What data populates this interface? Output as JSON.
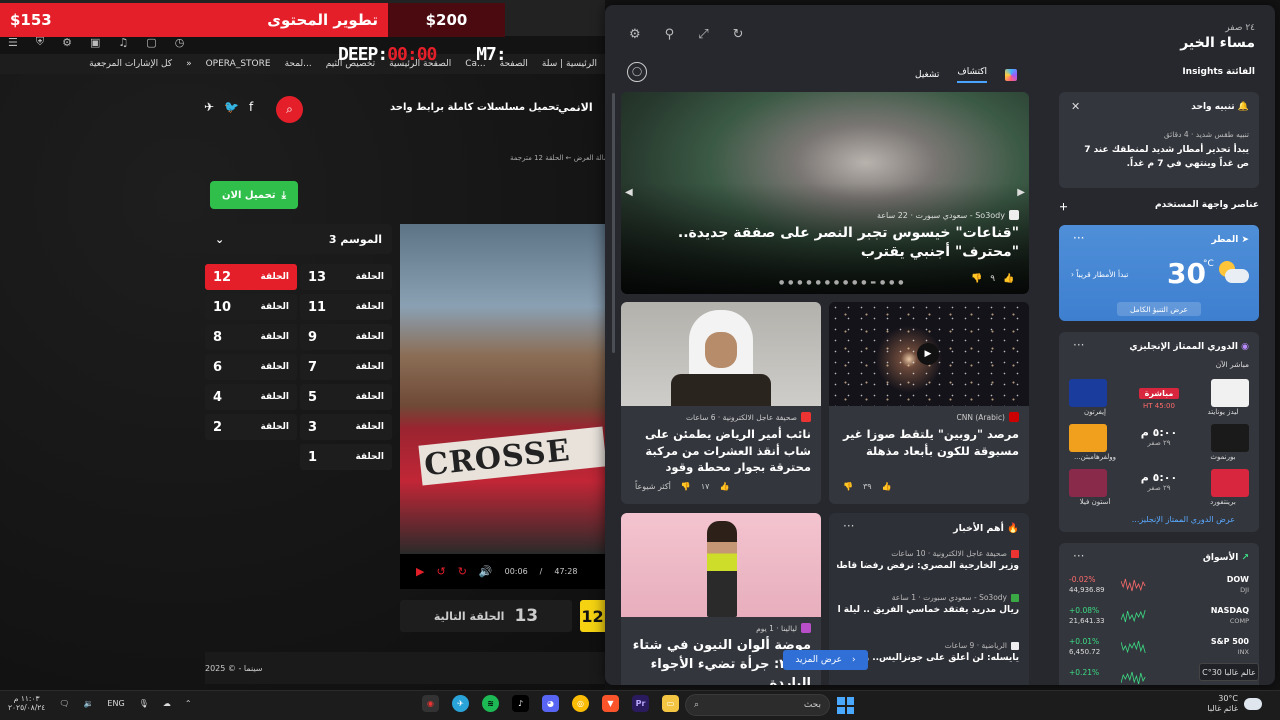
{
  "promo": {
    "label": "تطوير المحتوى",
    "price_a": "$153",
    "price_b": "$200"
  },
  "overlay": {
    "deep_label": "DEEP:",
    "deep_value": "00:00",
    "m7_label": "M7:"
  },
  "bookmarks": {
    "items": [
      "الرئيسية | سلة",
      "الصفحة",
      "Ca...",
      "الصفحة الرئيسية",
      "تخصيص الثيم",
      "لمحة...",
      "OPERA_STORE"
    ],
    "all_label": "كل الإشارات المرجعية"
  },
  "site": {
    "nav_anime": "الانمي",
    "download_link": "تحميل مسلسلات كاملة برابط واحد",
    "breadcrumb": "مالة العرض ← الحلقة 12 مترجمة",
    "download_button": "تحميل الان",
    "season_label": "الموسم 3",
    "episode_word": "الحلقة",
    "episodes": [
      {
        "num": "13",
        "active": false
      },
      {
        "num": "12",
        "active": true
      },
      {
        "num": "11",
        "active": false
      },
      {
        "num": "10",
        "active": false
      },
      {
        "num": "9",
        "active": false
      },
      {
        "num": "8",
        "active": false
      },
      {
        "num": "7",
        "active": false
      },
      {
        "num": "6",
        "active": false
      },
      {
        "num": "5",
        "active": false
      },
      {
        "num": "4",
        "active": false
      },
      {
        "num": "3",
        "active": false
      },
      {
        "num": "2",
        "active": false
      },
      {
        "num": "1",
        "active": false
      }
    ],
    "player": {
      "sign_text": "CROSSE",
      "time_current": "00:06",
      "time_total": "47:28"
    },
    "next_episode_label": "الحلقة التالية",
    "next_episode_num": "13",
    "current_episode_num": "12",
    "footer_text": "سينما - © 2025"
  },
  "widgets": {
    "date": "٢٤ صفر",
    "greeting": "مساء الخير",
    "insights_label": "Insights الفائتة",
    "tabs": [
      "اكتشاف",
      "تشغيل"
    ],
    "hero": {
      "source": "So3ody - سعودي سبورت · 22 ساعة",
      "title": "\"قناعات\" خيسوس تجبر النصر على صفقة جديدة.. \"محترف\" أجنبي يقترب",
      "likes": "٩"
    },
    "card_galaxy": {
      "source": "CNN (Arabic)",
      "title": "مرصد \"روبين\" يلتقط صوزا غير مسبوقة للكون بأبعاد مذهلة",
      "likes": "٣٩"
    },
    "card_prince": {
      "source": "صحيفة عاجل الالكترونية · 6 ساعات",
      "title": "نائب أمير الرياض يطمئن على شاب أنقذ العشرات من مركبة محترقة بجوار محطة وقود",
      "likes": "١٧",
      "trending": "أكثر شيوعاً"
    },
    "card_fashion": {
      "source": "ليالينا · 1 يوم",
      "title": "موضة ألوان النيون في شتاء ٢٠٢٦: جرأة تضيء الأجواء الباردة"
    },
    "top_news": {
      "title": "أهم الأخبار",
      "items": [
        {
          "source": "صحيفة عاجل الالكترونية · 10 ساعات",
          "title": "وزير الخارجية المصري: نرفض رفضا قاطعا تهجير الفلسطينيين من غزة وأوهام ما يسم..."
        },
        {
          "source": "So3ody - سعودي سبورت · 1 ساعة",
          "title": "ريال مدريد يفتقد خماسي الفريق .. ليلة البداية تتحول لكابوس ألونسو"
        },
        {
          "source": "الرياضية · 9 ساعات",
          "title": "يايسله: لن أعلق على جونزاليس.. والتعاقد..."
        }
      ]
    },
    "see_more": "عرض المزيد",
    "alert": {
      "title": "تنبيه واحد",
      "source": "تنبيه طقس شديد · 4 دقائق",
      "text": "يبدأ تحذير أمطار شديد لمنطقك عند 7 ص غداً وينتهي في 7 م غداً."
    },
    "ui_elements_label": "عناصر واجهة المستخدم",
    "weather": {
      "title": "المطر",
      "temp": "30",
      "unit": "°C",
      "rain_note": "تبدأ الأمطار قريباً",
      "forecast_button": "عرض التنبؤ الكامل"
    },
    "league": {
      "title": "الدوري الممتاز الإنجليزي",
      "live_label": "مباشر الآن",
      "matches": [
        {
          "home": "ليدز يونايتد",
          "away": "إيفرتون",
          "center": "مباشرة",
          "sub": "HT 45:00",
          "home_color": "#f1f1f1",
          "away_color": "#1a3c9c"
        },
        {
          "home": "بورنموث",
          "away": "وولفرهامبتن...",
          "center": "٥:٠٠ م",
          "sub": "٢٩ صفر",
          "home_color": "#1a1a1a",
          "away_color": "#f0a01c"
        },
        {
          "home": "برينتفورد",
          "away": "أستون فيلا",
          "center": "٥:٠٠ م",
          "sub": "٢٩ صفر",
          "home_color": "#d7263d",
          "away_color": "#8a2a4b"
        }
      ],
      "link": "عرض الدوري الممتاز الإنجليز..."
    },
    "markets": {
      "title": "الأسواق",
      "rows": [
        {
          "name": "DOW",
          "sub": "DJI",
          "change": "-0.02%",
          "value": "44,936.89",
          "color": "#ff6b6b"
        },
        {
          "name": "NASDAQ",
          "sub": "COMP",
          "change": "+0.08%",
          "value": "21,641.33",
          "color": "#3ddc84"
        },
        {
          "name": "S&P 500",
          "sub": "INX",
          "change": "+0.01%",
          "value": "6,450.72",
          "color": "#3ddc84"
        },
        {
          "name": "",
          "sub": "",
          "change": "+0.21%",
          "value": "",
          "color": "#3ddc84"
        }
      ]
    },
    "mini_weather": "عالم غالبا 30°C"
  },
  "taskbar": {
    "search": "بحث",
    "weather_temp": "30°C",
    "weather_text": "غائم غالبا",
    "lang": "ENG",
    "time": "١١:٠٣ م",
    "date": "٢٠٢٥/٠٨/٢٤"
  }
}
